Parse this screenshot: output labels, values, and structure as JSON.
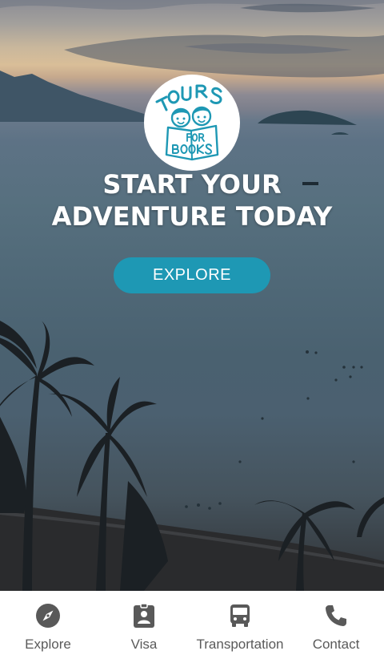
{
  "hero": {
    "logo_text": [
      "TOURS",
      "FOR",
      "BOOKS"
    ],
    "headline_line1": "START YOUR",
    "headline_line2": "ADVENTURE TODAY",
    "explore_button": "EXPLORE"
  },
  "tabbar": {
    "items": [
      {
        "label": "Explore",
        "icon": "compass-icon"
      },
      {
        "label": "Visa",
        "icon": "id-badge-icon"
      },
      {
        "label": "Transportation",
        "icon": "bus-icon"
      },
      {
        "label": "Contact",
        "icon": "phone-icon"
      }
    ]
  },
  "colors": {
    "accent": "#1e98b4",
    "tab_icon": "#595959",
    "tab_label": "#5a5a5a",
    "headline": "#ffffff"
  }
}
